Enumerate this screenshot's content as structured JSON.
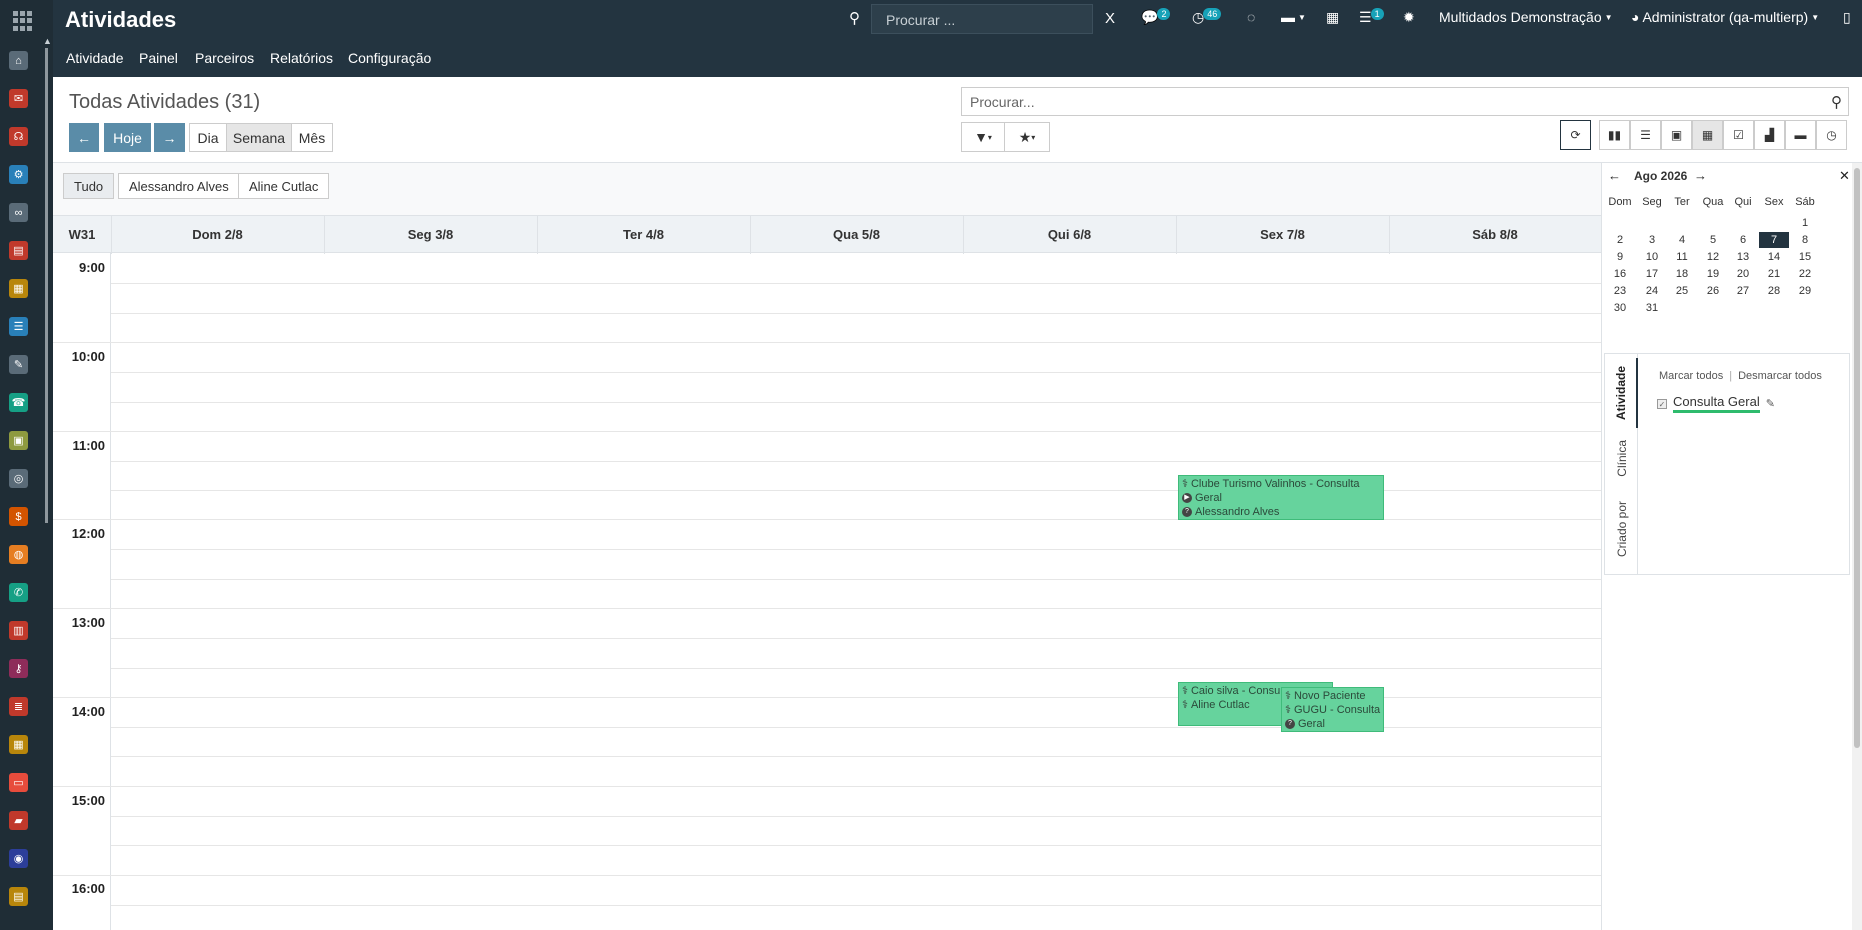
{
  "app": {
    "title": "Atividades"
  },
  "topbar": {
    "search_placeholder": "Procurar ...",
    "clear_label": "X",
    "messages_count": "2",
    "activities_count": "46",
    "tasks_count": "1",
    "company": "Multidados Demonstração",
    "user": "Administrator (qa-multierp)"
  },
  "menu": {
    "items": [
      "Atividade",
      "Painel",
      "Parceiros",
      "Relatórios",
      "Configuração"
    ]
  },
  "control": {
    "title": "Todas Atividades (31)",
    "today_label": "Hoje",
    "scale_day": "Dia",
    "scale_week": "Semana",
    "scale_month": "Mês",
    "search_placeholder": "Procurar..."
  },
  "attendees": [
    "Tudo",
    "Alessandro Alves",
    "Aline Cutlac"
  ],
  "calendar": {
    "week_label": "W31",
    "days": [
      "Dom 2/8",
      "Seg 3/8",
      "Ter 4/8",
      "Qua 5/8",
      "Qui 6/8",
      "Sex 7/8",
      "Sáb 8/8"
    ],
    "hours": [
      "9:00",
      "10:00",
      "11:00",
      "12:00",
      "13:00",
      "14:00",
      "15:00",
      "16:00"
    ],
    "events": [
      {
        "lines": [
          "Clube Turismo Valinhos - Consulta",
          "Geral",
          "Alessandro Alves"
        ]
      },
      {
        "lines": [
          "Caio silva - Consu",
          "Aline Cutlac"
        ]
      },
      {
        "lines": [
          "Novo Paciente",
          "GUGU - Consulta",
          "Geral"
        ]
      }
    ]
  },
  "mini_calendar": {
    "month": "Ago 2026",
    "dow": [
      "Dom",
      "Seg",
      "Ter",
      "Qua",
      "Qui",
      "Sex",
      "Sáb"
    ],
    "selected_day": "7",
    "weeks": [
      [
        "",
        "",
        "",
        "",
        "",
        "",
        "1"
      ],
      [
        "2",
        "3",
        "4",
        "5",
        "6",
        "7",
        "8"
      ],
      [
        "9",
        "10",
        "11",
        "12",
        "13",
        "14",
        "15"
      ],
      [
        "16",
        "17",
        "18",
        "19",
        "20",
        "21",
        "22"
      ],
      [
        "23",
        "24",
        "25",
        "26",
        "27",
        "28",
        "29"
      ],
      [
        "30",
        "31",
        "",
        "",
        "",
        "",
        ""
      ]
    ]
  },
  "sidebar": {
    "tabs": [
      "Atividade",
      "Clínica",
      "Criado por"
    ],
    "mark_all": "Marcar todos",
    "unmark_all": "Desmarcar todos",
    "filter_label": "Consulta Geral"
  },
  "colors": {
    "topbar": "#233440",
    "event": "#66d39d",
    "primary": "#5a8ca8",
    "filter_underline": "#2ebb6d"
  }
}
